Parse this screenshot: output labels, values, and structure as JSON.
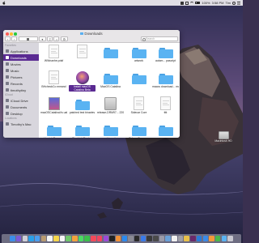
{
  "menubar": {
    "time": "3:58 PM",
    "user": "Tim",
    "battery": "100%"
  },
  "finder": {
    "title": "Downloads",
    "search_placeholder": "Search",
    "sidebar": {
      "favorites_header": "Favorites",
      "favorites": [
        {
          "label": "Applications",
          "icon": "applications-icon",
          "color": "#7a7a88"
        },
        {
          "label": "Downloads",
          "icon": "downloads-icon",
          "color": "#2e8ef0",
          "active": true
        },
        {
          "label": "Movies",
          "icon": "movies-icon",
          "color": "#7a7a88"
        },
        {
          "label": "Music",
          "icon": "music-icon",
          "color": "#7a7a88"
        },
        {
          "label": "Pictures",
          "icon": "pictures-icon",
          "color": "#7a7a88"
        },
        {
          "label": "Records",
          "icon": "folder-icon",
          "color": "#7a7a88"
        },
        {
          "label": "timothytiny",
          "icon": "home-icon",
          "color": "#7a7a88"
        }
      ],
      "icloud_header": "iCloud",
      "icloud": [
        {
          "label": "iCloud Drive",
          "icon": "cloud-icon",
          "color": "#7a7a88"
        },
        {
          "label": "Documents",
          "icon": "documents-icon",
          "color": "#7a7a88"
        },
        {
          "label": "Desktop",
          "icon": "desktop-icon",
          "color": "#7a7a88"
        }
      ],
      "locations_header": "Locations",
      "locations": [
        {
          "label": "Timothy's Mac",
          "icon": "laptop-icon",
          "color": "#7a7a88"
        }
      ]
    },
    "files": [
      {
        "label": "WWnanhe.pdsf",
        "kind": "doc"
      },
      {
        "label": "",
        "kind": "doc"
      },
      {
        "label": "",
        "kind": "folder"
      },
      {
        "label": "artwork",
        "kind": "folder"
      },
      {
        "label": "autom... pascript",
        "kind": "folder"
      },
      {
        "label": "BHcheckCo mmand",
        "kind": "doc"
      },
      {
        "label": "Install macOS Catalina Beta",
        "kind": "installer",
        "selected": true
      },
      {
        "label": "MacOS Catalina",
        "kind": "folder"
      },
      {
        "label": "",
        "kind": "folder"
      },
      {
        "label": "macos download... master",
        "kind": "folder"
      },
      {
        "label": "macOSCatalinaVs ualpaeBeta.dmg",
        "kind": "dmg"
      },
      {
        "label": "patched test binaries",
        "kind": "folder"
      },
      {
        "label": "release-DRM97... 220818",
        "kind": "disk"
      },
      {
        "label": "Sidecar Core",
        "kind": "doc"
      },
      {
        "label": "tttt",
        "kind": "doc"
      },
      {
        "label": "blauightDameos",
        "kind": "folder"
      },
      {
        "label": "BlocLightEngine",
        "kind": "folder"
      },
      {
        "label": "shipped",
        "kind": "folder"
      },
      {
        "label": "SidecarDemos...",
        "kind": "folder"
      },
      {
        "label": "",
        "kind": "folder"
      }
    ]
  },
  "desktop": {
    "item_label": "Macintosh HD"
  },
  "dock": {
    "icons": [
      {
        "name": "finder-icon",
        "color": "#3d8de8"
      },
      {
        "name": "siri-icon",
        "color": "#7a5ad8"
      },
      {
        "name": "launchpad-icon",
        "color": "#cfcfd6"
      },
      {
        "name": "safari-icon",
        "color": "#2aa0e8"
      },
      {
        "name": "mail-icon",
        "color": "#4a9ef0"
      },
      {
        "name": "contacts-icon",
        "color": "#b89a70"
      },
      {
        "name": "calendar-icon",
        "color": "#f4f4f4"
      },
      {
        "name": "notes-icon",
        "color": "#f6d64a"
      },
      {
        "name": "reminders-icon",
        "color": "#f4f4f4"
      },
      {
        "name": "maps-icon",
        "color": "#6ec66a"
      },
      {
        "name": "photos-icon",
        "color": "#f2a23c"
      },
      {
        "name": "messages-icon",
        "color": "#4cd964"
      },
      {
        "name": "facetime-icon",
        "color": "#3bbf4a"
      },
      {
        "name": "news-icon",
        "color": "#f24a5a"
      },
      {
        "name": "music-icon",
        "color": "#f2445e"
      },
      {
        "name": "podcasts-icon",
        "color": "#9a4ad8"
      },
      {
        "name": "tv-icon",
        "color": "#222222"
      },
      {
        "name": "books-icon",
        "color": "#f2923a"
      },
      {
        "name": "app-store-icon",
        "color": "#2a8af0"
      },
      {
        "name": "system-preferences-icon",
        "color": "#8a8a94"
      },
      {
        "name": "terminal-icon",
        "color": "#2a2a2a"
      },
      {
        "name": "xcode-icon",
        "color": "#3a7ae8"
      },
      {
        "name": "activity-monitor-icon",
        "color": "#3a3a3a"
      },
      {
        "name": "console-icon",
        "color": "#4a4a4a"
      },
      {
        "name": "script-editor-icon",
        "color": "#9a9aa8"
      },
      {
        "name": "preview-icon",
        "color": "#6aa0d8"
      },
      {
        "name": "textedit-icon",
        "color": "#f0f0f0"
      },
      {
        "name": "disk-utility-icon",
        "color": "#a0a0a8"
      },
      {
        "name": "chrome-icon",
        "color": "#e8c04a"
      },
      {
        "name": "slack-icon",
        "color": "#6a2a6a"
      },
      {
        "name": "vscode-icon",
        "color": "#2a7ad8"
      },
      {
        "name": "keynote-icon",
        "color": "#3a8ae8"
      },
      {
        "name": "pages-icon",
        "color": "#f29a3a"
      },
      {
        "name": "numbers-icon",
        "color": "#4ab84a"
      },
      {
        "name": "downloads-stack-icon",
        "color": "#5ab3f2"
      },
      {
        "name": "trash-icon",
        "color": "#c8c8d0"
      }
    ]
  }
}
